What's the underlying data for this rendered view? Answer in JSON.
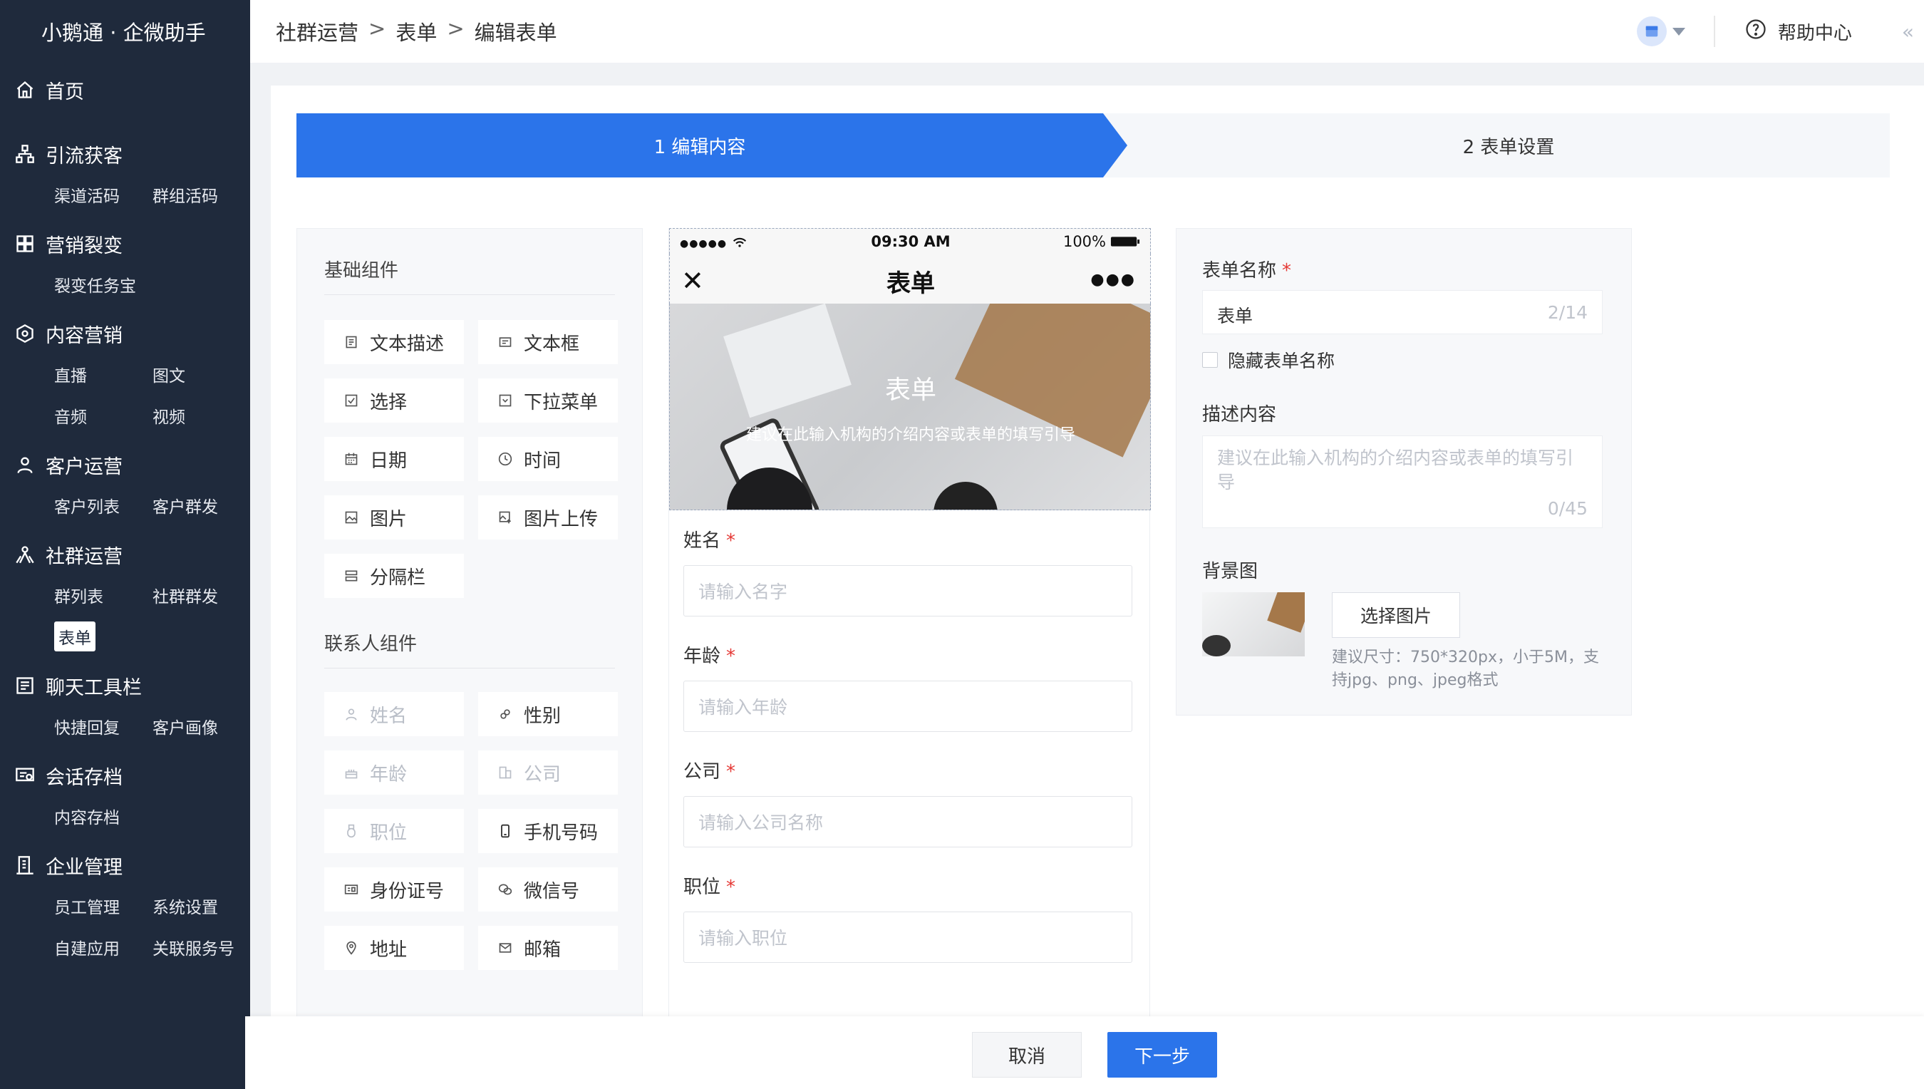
{
  "app": {
    "brand": "小鹅通 · 企微助手"
  },
  "sidebar": {
    "groups": [
      {
        "title": "首页",
        "icon": "home-icon",
        "items": []
      },
      {
        "title": "引流获客",
        "icon": "sitemap-icon",
        "items": [
          "渠道活码",
          "群组活码"
        ]
      },
      {
        "title": "营销裂变",
        "icon": "grid-icon",
        "items": [
          "裂变任务宝"
        ]
      },
      {
        "title": "内容营销",
        "icon": "content-icon",
        "items": [
          "直播",
          "图文",
          "音频",
          "视频"
        ]
      },
      {
        "title": "客户运营",
        "icon": "user-icon",
        "items": [
          "客户列表",
          "客户群发"
        ]
      },
      {
        "title": "社群运营",
        "icon": "group-icon",
        "items": [
          "群列表",
          "社群群发",
          "表单"
        ]
      },
      {
        "title": "聊天工具栏",
        "icon": "toolbar-icon",
        "items": [
          "快捷回复",
          "客户画像"
        ]
      },
      {
        "title": "会话存档",
        "icon": "archive-icon",
        "items": [
          "内容存档"
        ]
      },
      {
        "title": "企业管理",
        "icon": "building-icon",
        "items": [
          "员工管理",
          "系统设置",
          "自建应用",
          "关联服务号"
        ]
      }
    ],
    "active_item": "表单"
  },
  "header": {
    "breadcrumb": [
      "社群运营",
      "表单",
      "编辑表单"
    ],
    "separator": ">",
    "help_label": "帮助中心",
    "collapse_glyph": "«"
  },
  "steps": {
    "step1": "1 编辑内容",
    "step2": "2 表单设置"
  },
  "palette": {
    "basic_title": "基础组件",
    "basic": [
      {
        "label": "文本描述",
        "icon": "text-desc-icon"
      },
      {
        "label": "文本框",
        "icon": "textbox-icon"
      },
      {
        "label": "选择",
        "icon": "checkbox-icon"
      },
      {
        "label": "下拉菜单",
        "icon": "dropdown-icon"
      },
      {
        "label": "日期",
        "icon": "calendar-icon"
      },
      {
        "label": "时间",
        "icon": "clock-icon"
      },
      {
        "label": "图片",
        "icon": "image-icon"
      },
      {
        "label": "图片上传",
        "icon": "image-upload-icon"
      },
      {
        "label": "分隔栏",
        "icon": "divider-icon"
      }
    ],
    "contact_title": "联系人组件",
    "contact": [
      {
        "label": "姓名",
        "icon": "person-icon",
        "disabled": true
      },
      {
        "label": "性别",
        "icon": "gender-icon",
        "disabled": false
      },
      {
        "label": "年龄",
        "icon": "cake-icon",
        "disabled": true
      },
      {
        "label": "公司",
        "icon": "company-icon",
        "disabled": true
      },
      {
        "label": "职位",
        "icon": "badge-icon",
        "disabled": true
      },
      {
        "label": "手机号码",
        "icon": "phone-icon",
        "disabled": false
      },
      {
        "label": "身份证号",
        "icon": "id-card-icon",
        "disabled": false
      },
      {
        "label": "微信号",
        "icon": "wechat-icon",
        "disabled": false
      },
      {
        "label": "地址",
        "icon": "location-icon",
        "disabled": false
      },
      {
        "label": "邮箱",
        "icon": "mail-icon",
        "disabled": false
      }
    ]
  },
  "preview": {
    "status_dots": "●●●●●",
    "status_time": "09:30 AM",
    "battery": "100%",
    "close_glyph": "✕",
    "more_glyph": "●●●",
    "title": "表单",
    "banner_title": "表单",
    "banner_desc": "建议在此输入机构的介绍内容或表单的填写引导",
    "fields": [
      {
        "label": "姓名",
        "placeholder": "请输入名字"
      },
      {
        "label": "年龄",
        "placeholder": "请输入年龄"
      },
      {
        "label": "公司",
        "placeholder": "请输入公司名称"
      },
      {
        "label": "职位",
        "placeholder": "请输入职位"
      }
    ],
    "required_mark": "*"
  },
  "settings": {
    "name_label": "表单名称",
    "name_value": "表单",
    "name_count": "2/14",
    "hide_name_label": "隐藏表单名称",
    "desc_label": "描述内容",
    "desc_placeholder": "建议在此输入机构的介绍内容或表单的填写引导",
    "desc_count": "0/45",
    "bg_label": "背景图",
    "pick_button": "选择图片",
    "hint": "建议尺寸：750*320px，小于5M，支持jpg、png、jpeg格式"
  },
  "footer": {
    "cancel": "取消",
    "next": "下一步"
  },
  "colors": {
    "primary": "#2b74ea",
    "sidebar": "#1f2a3c",
    "required": "#e53935"
  }
}
